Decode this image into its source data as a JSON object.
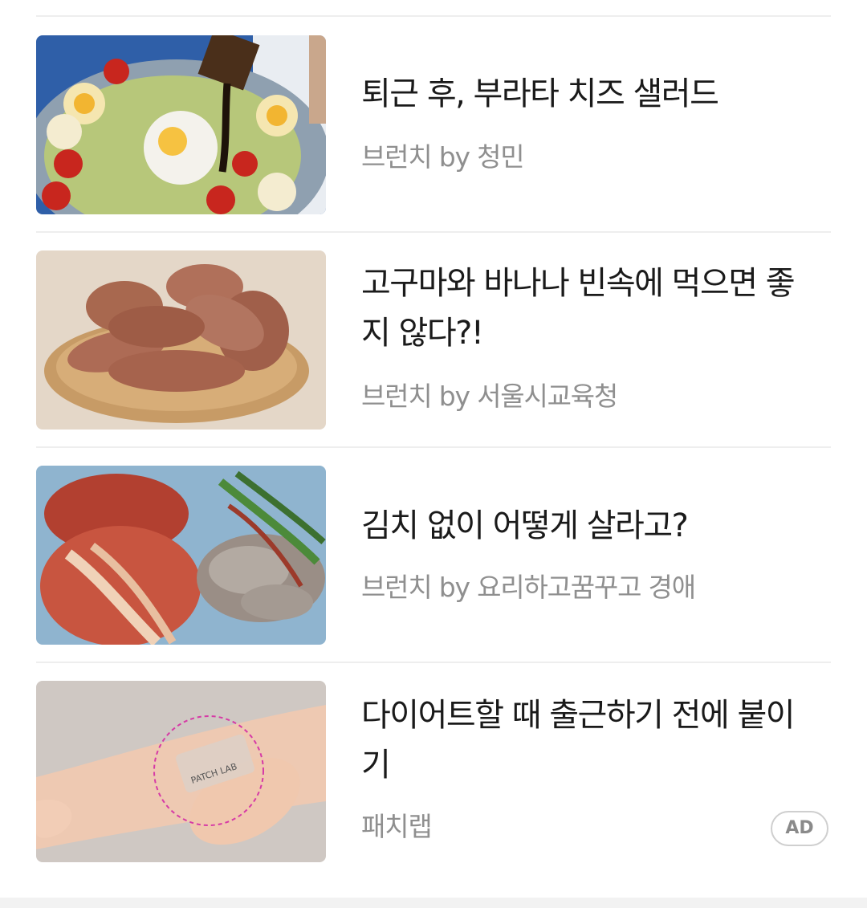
{
  "feed": {
    "items": [
      {
        "title": "퇴근 후, 부라타 치즈 샐러드",
        "meta": "브런치 by 청민",
        "image_icon": "salad-image"
      },
      {
        "title": "고구마와 바나나 빈속에 먹으면 좋지 않다?!",
        "meta": "브런치 by 서울시교육청",
        "image_icon": "sweet-potato-image"
      },
      {
        "title": "김치 없이 어떻게 살라고?",
        "meta": "브런치 by 요리하고꿈꾸고 경애",
        "image_icon": "kimchi-image"
      },
      {
        "title": "다이어트할 때 출근하기 전에 붙이기",
        "meta": "패치랩",
        "badge": "AD",
        "image_icon": "patch-image",
        "image_text": "PATCH LAB"
      }
    ]
  },
  "colors": {
    "title": "#1a1a1a",
    "meta": "#8f8f8f",
    "divider": "#eeeeee",
    "badge_border": "#cfcfcf"
  }
}
